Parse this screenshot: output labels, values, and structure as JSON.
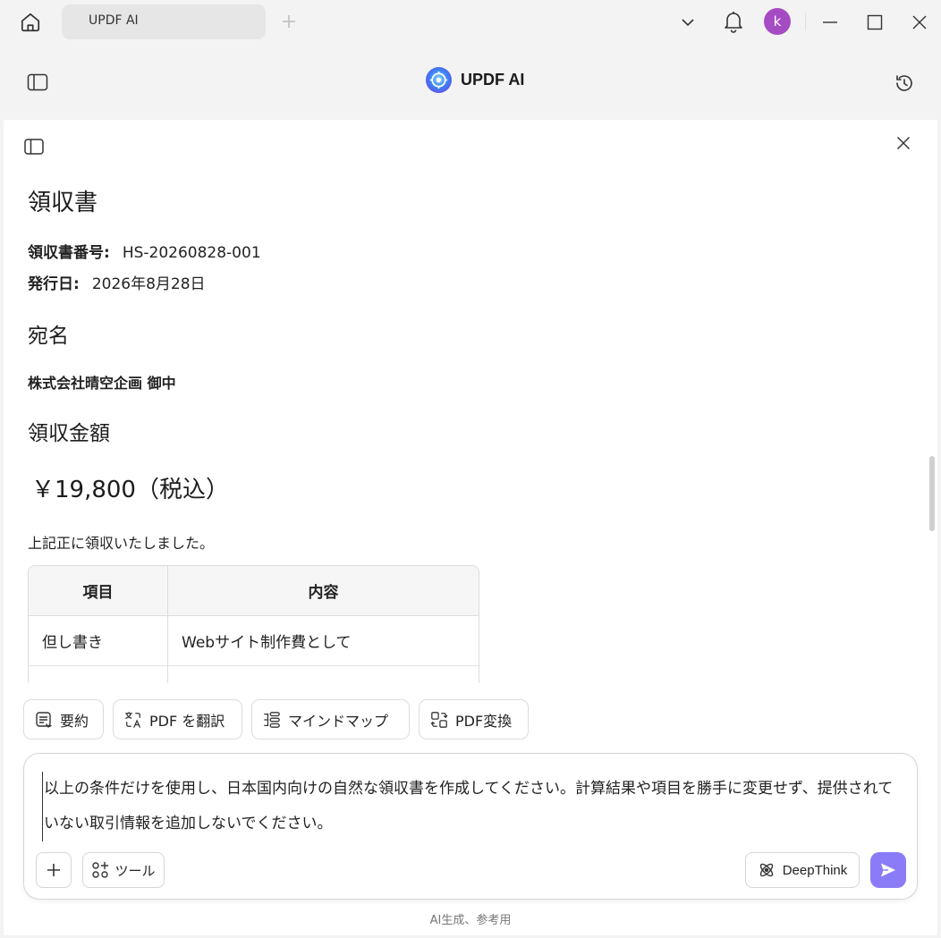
{
  "window": {
    "tab_title": "UPDF AI",
    "avatar_initial": "k"
  },
  "header": {
    "brand_name": "UPDF AI"
  },
  "document": {
    "title": "領収書",
    "receipt_number_label": "領収書番号:",
    "receipt_number": "HS-20260828-001",
    "issue_date_label": "発行日:",
    "issue_date": "2026年8月28日",
    "recipient_heading": "宛名",
    "recipient": "株式会社晴空企画 御中",
    "amount_heading": "領収金額",
    "amount": "￥19,800（税込）",
    "note": "上記正に領収いたしました。",
    "table": {
      "headers": [
        "項目",
        "内容"
      ],
      "rows": [
        [
          "但し書き",
          "Webサイト制作費として"
        ]
      ]
    }
  },
  "quick_actions": [
    {
      "label": "要約",
      "icon": "summary-icon"
    },
    {
      "label": "PDF を翻訳",
      "icon": "translate-icon"
    },
    {
      "label": "マインドマップ",
      "icon": "mindmap-icon"
    },
    {
      "label": "PDF変換",
      "icon": "convert-icon"
    }
  ],
  "input": {
    "text": "以上の条件だけを使用し、日本国内向けの自然な領収書を作成してください。計算結果や項目を勝手に変更せず、提供されていない取引情報を追加しないでください。",
    "tools_label": "ツール",
    "deepthink_label": "DeepThink"
  },
  "footer": {
    "note": "AI生成、参考用"
  },
  "colors": {
    "avatar": "#a54bc4",
    "send_button": "#8a7cf6",
    "brand_logo": "#3b7df2"
  }
}
